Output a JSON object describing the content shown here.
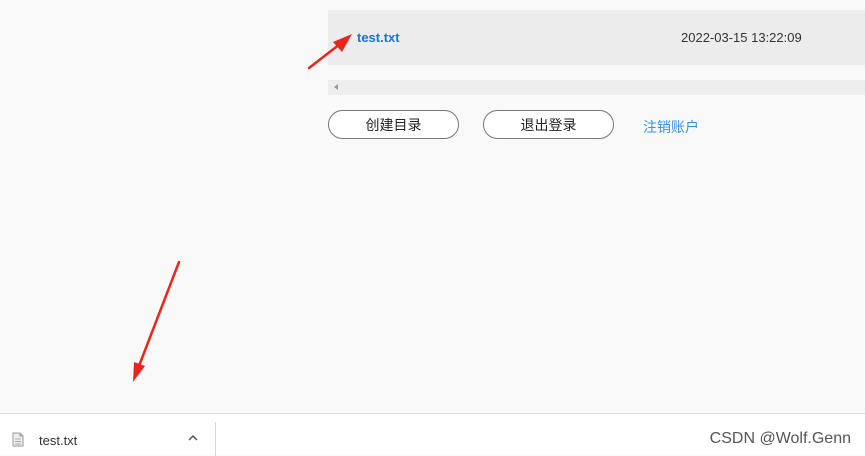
{
  "file_list": {
    "rows": [
      {
        "name": "test.txt",
        "date": "2022-03-15 13:22:09"
      }
    ]
  },
  "actions": {
    "create_dir_label": "创建目录",
    "logout_label": "退出登录",
    "cancel_account_label": "注销账户"
  },
  "download_bar": {
    "file_name": "test.txt",
    "file_icon": "document-icon",
    "chevron_icon": "chevron-up-icon"
  },
  "watermark": "CSDN @Wolf.Genn",
  "colors": {
    "link": "#1a73d6",
    "secondary_link": "#3d8ee6",
    "annotation_arrow": "#e8261c",
    "row_background": "#ececec"
  }
}
